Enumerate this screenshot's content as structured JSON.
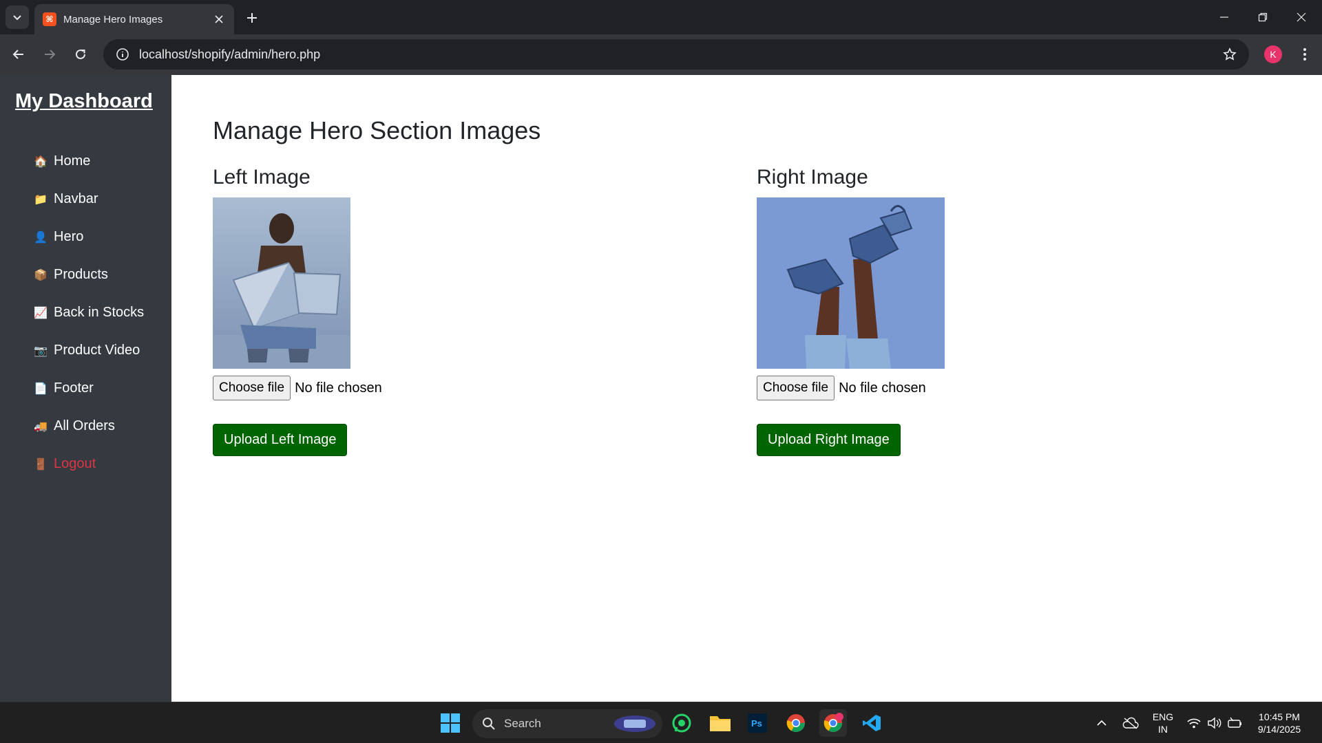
{
  "browser": {
    "tab_title": "Manage Hero Images",
    "url": "localhost/shopify/admin/hero.php",
    "profile_initial": "K",
    "favicon_letter": "■"
  },
  "sidebar": {
    "brand": "My Dashboard",
    "items": [
      {
        "label": "Home",
        "icon": "home-icon",
        "glyph": "🏠"
      },
      {
        "label": "Navbar",
        "icon": "folder-icon",
        "glyph": "📁"
      },
      {
        "label": "Hero",
        "icon": "person-icon",
        "glyph": "👤"
      },
      {
        "label": "Products",
        "icon": "package-icon",
        "glyph": "📦"
      },
      {
        "label": "Back in Stocks",
        "icon": "chart-icon",
        "glyph": "📈"
      },
      {
        "label": "Product Video",
        "icon": "camera-icon",
        "glyph": "📷"
      },
      {
        "label": "Footer",
        "icon": "document-icon",
        "glyph": "📄"
      },
      {
        "label": "All Orders",
        "icon": "truck-icon",
        "glyph": "🚚"
      },
      {
        "label": "Logout",
        "icon": "door-icon",
        "glyph": "🚪"
      }
    ]
  },
  "main": {
    "title": "Manage Hero Section Images",
    "left": {
      "heading": "Left Image",
      "choose_label": "Choose file",
      "file_status": "No file chosen",
      "upload_label": "Upload Left Image"
    },
    "right": {
      "heading": "Right Image",
      "choose_label": "Choose file",
      "file_status": "No file chosen",
      "upload_label": "Upload Right Image"
    }
  },
  "taskbar": {
    "search_label": "Search",
    "lang_top": "ENG",
    "lang_bottom": "IN",
    "time": "10:45 PM",
    "date": "9/14/2025"
  },
  "colors": {
    "sidebar_bg": "#343a40",
    "upload_button": "#006400",
    "logout": "#dc3545"
  }
}
